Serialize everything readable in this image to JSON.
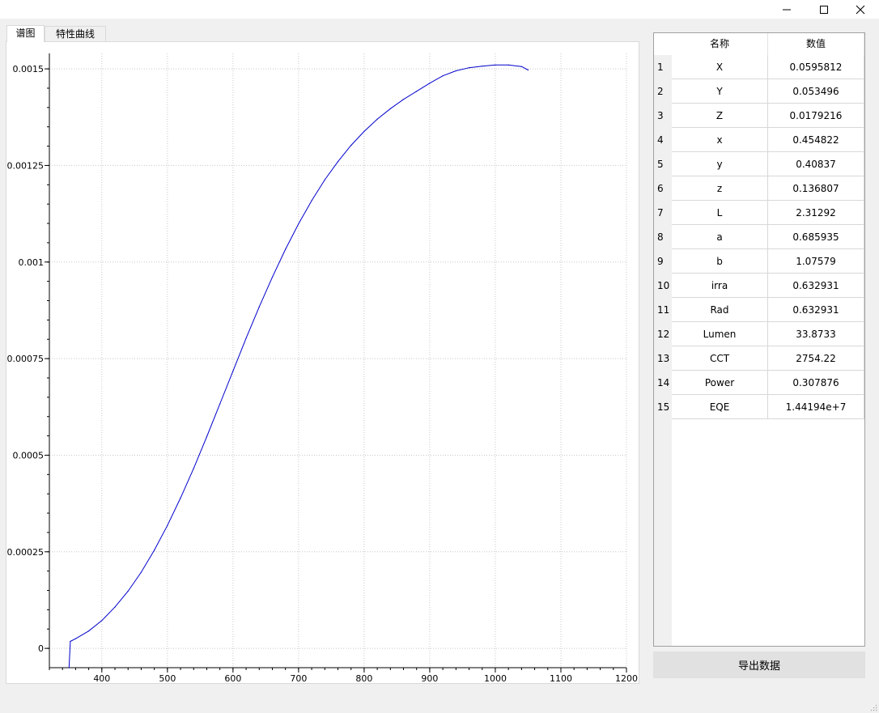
{
  "tabs": [
    {
      "label": "谱图",
      "active": true
    },
    {
      "label": "特性曲线",
      "active": false
    }
  ],
  "window_controls": {
    "minimize_icon": "minimize-icon",
    "maximize_icon": "maximize-icon",
    "close_icon": "close-icon"
  },
  "chart_data": {
    "type": "line",
    "title": "",
    "xlabel": "",
    "ylabel": "",
    "xlim": [
      320,
      1200
    ],
    "ylim": [
      -5e-05,
      0.00154
    ],
    "x_ticks": [
      400,
      500,
      600,
      700,
      800,
      900,
      1000,
      1100,
      1200
    ],
    "y_ticks": [
      0,
      0.00025,
      0.0005,
      0.00075,
      0.001,
      0.00125,
      0.0015
    ],
    "y_tick_labels": [
      "0",
      "0.00025",
      "0.0005",
      "0.00075",
      "0.001",
      "0.00125",
      "0.0015"
    ],
    "grid": true,
    "series_color": "#0000cc",
    "series": [
      {
        "x": [
          350,
          352,
          360,
          380,
          400,
          420,
          440,
          460,
          480,
          500,
          520,
          540,
          560,
          580,
          600,
          620,
          640,
          660,
          680,
          700,
          720,
          740,
          760,
          780,
          800,
          820,
          840,
          860,
          880,
          900,
          920,
          940,
          960,
          980,
          1000,
          1020,
          1040,
          1050
        ],
        "y": [
          -5e-05,
          1.8e-05,
          2.5e-05,
          4.5e-05,
          7.2e-05,
          0.000107,
          0.000148,
          0.000197,
          0.000254,
          0.000318,
          0.000389,
          0.000466,
          0.000548,
          0.000633,
          0.000718,
          0.000803,
          0.000884,
          0.000961,
          0.001033,
          0.001099,
          0.001159,
          0.001213,
          0.00126,
          0.001302,
          0.001338,
          0.00137,
          0.001397,
          0.001421,
          0.001442,
          0.001463,
          0.001482,
          0.001495,
          0.001503,
          0.001507,
          0.00151,
          0.00151,
          0.001506,
          0.001497
        ]
      }
    ]
  },
  "table": {
    "headers": [
      "名称",
      "数值"
    ],
    "rows": [
      {
        "index": "1",
        "name": "X",
        "value": "0.0595812"
      },
      {
        "index": "2",
        "name": "Y",
        "value": "0.053496"
      },
      {
        "index": "3",
        "name": "Z",
        "value": "0.0179216"
      },
      {
        "index": "4",
        "name": "x",
        "value": "0.454822"
      },
      {
        "index": "5",
        "name": "y",
        "value": "0.40837"
      },
      {
        "index": "6",
        "name": "z",
        "value": "0.136807"
      },
      {
        "index": "7",
        "name": "L",
        "value": "2.31292"
      },
      {
        "index": "8",
        "name": "a",
        "value": "0.685935"
      },
      {
        "index": "9",
        "name": "b",
        "value": "1.07579"
      },
      {
        "index": "10",
        "name": "irra",
        "value": "0.632931"
      },
      {
        "index": "11",
        "name": "Rad",
        "value": "0.632931"
      },
      {
        "index": "12",
        "name": "Lumen",
        "value": "33.8733"
      },
      {
        "index": "13",
        "name": "CCT",
        "value": "2754.22"
      },
      {
        "index": "14",
        "name": "Power",
        "value": "0.307876"
      },
      {
        "index": "15",
        "name": "EQE",
        "value": "1.44194e+7"
      }
    ]
  },
  "export_button": {
    "label": "导出数据"
  }
}
